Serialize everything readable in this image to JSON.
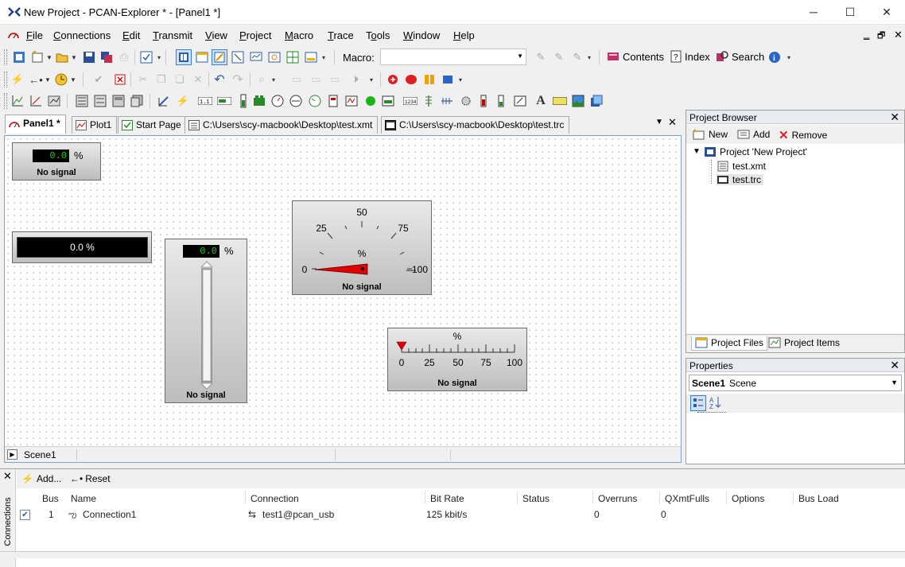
{
  "window": {
    "title": "New Project - PCAN-Explorer * - [Panel1 *]",
    "minimize": "─",
    "maximize": "☐",
    "close": "✕"
  },
  "menu": [
    "File",
    "Connections",
    "Edit",
    "Transmit",
    "View",
    "Project",
    "Macro",
    "Trace",
    "Tools",
    "Window",
    "Help"
  ],
  "menu_accel": [
    "F",
    "C",
    "E",
    "T",
    "V",
    "P",
    "M",
    "T",
    "o",
    "W",
    "H"
  ],
  "mdi_controls": {
    "minimize": "‗",
    "restore": "🗗",
    "close": "✕"
  },
  "toolbar": {
    "macro_label": "Macro:",
    "macro_value": "",
    "contents": "Contents",
    "index": "Index",
    "search": "Search"
  },
  "tabs": [
    {
      "label": "Panel1 *",
      "active": true
    },
    {
      "label": "Plot1",
      "active": false
    },
    {
      "label": "Start Page",
      "active": false
    },
    {
      "label": "C:\\Users\\scy-macbook\\Desktop\\test.xmt",
      "active": false
    },
    {
      "label": "C:\\Users\\scy-macbook\\Desktop\\test.trc",
      "active": false
    }
  ],
  "tab_controls": {
    "dropdown": "▼",
    "close": "✕"
  },
  "panel": {
    "display1": {
      "value": "0.0",
      "unit": "%",
      "status": "No signal"
    },
    "bar_display": {
      "text": "0.0 %"
    },
    "vslider": {
      "value": "0.0",
      "unit": "%",
      "status": "No signal",
      "level": 0
    },
    "gauge": {
      "ticks": [
        "0",
        "25",
        "50",
        "75",
        "100"
      ],
      "minus": "—",
      "unit": "%",
      "status": "No signal",
      "needle_value": 0
    },
    "hscale": {
      "unit": "%",
      "ticks": [
        "0",
        "25",
        "50",
        "75",
        "100"
      ],
      "status": "No signal",
      "pointer_value": 0
    },
    "scene": "Scene1"
  },
  "project_browser": {
    "title": "Project Browser",
    "new": "New",
    "add": "Add",
    "remove": "Remove",
    "tree": {
      "root": "Project 'New Project'",
      "children": [
        "test.xmt",
        "test.trc"
      ]
    },
    "tabs": [
      "Project Files",
      "Project Items"
    ]
  },
  "properties": {
    "title": "Properties",
    "selected_bold": "Scene1",
    "selected_rest": "Scene"
  },
  "connections": {
    "side_label": "Connections",
    "add": "Add...",
    "reset": "Reset",
    "columns": [
      "Bus",
      "Name",
      "Connection",
      "Bit Rate",
      "Status",
      "Overruns",
      "QXmtFulls",
      "Options",
      "Bus Load"
    ],
    "rows": [
      {
        "checked": true,
        "bus": "1",
        "name": "Connection1",
        "connection": "test1@pcan_usb",
        "bitrate": "125 kbit/s",
        "status": "",
        "overruns": "0",
        "qxmtfulls": "0",
        "options": "",
        "busload": ""
      }
    ]
  },
  "colors": {
    "accent": "#0a64b4",
    "lcd_text": "#10d010",
    "needle": "#e00000"
  }
}
